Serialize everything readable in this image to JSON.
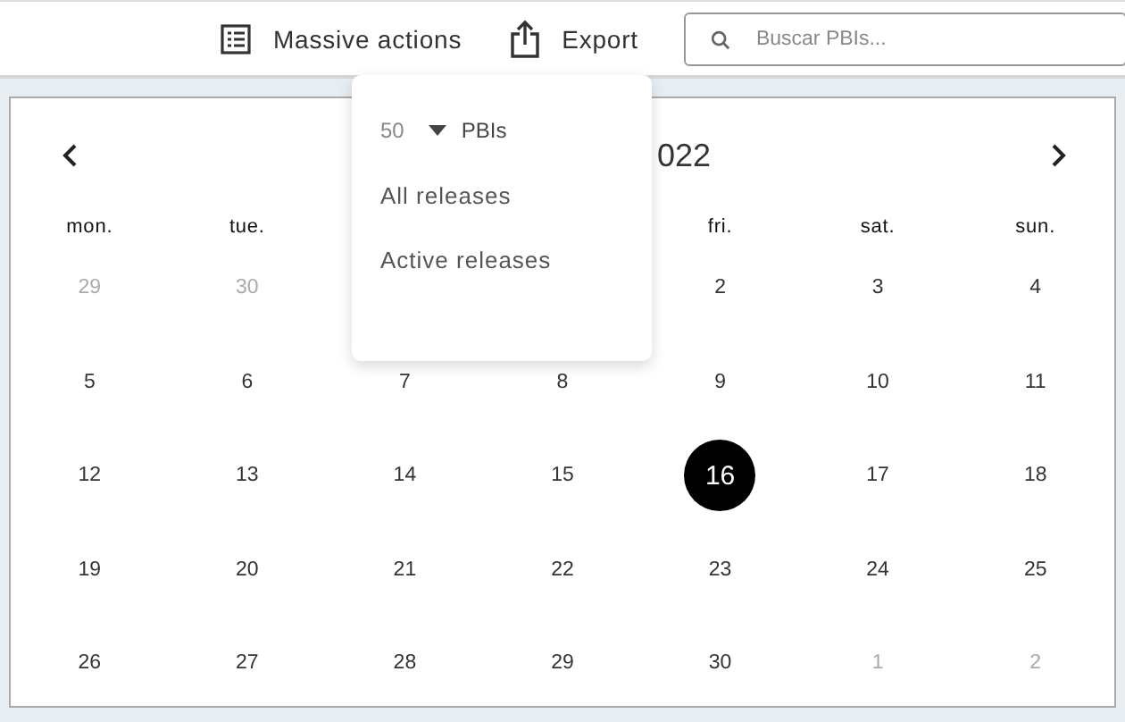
{
  "toolbar": {
    "massive_actions": "Massive actions",
    "export": "Export",
    "search": {
      "placeholder": "Buscar PBIs..."
    }
  },
  "calendar": {
    "title_visible": "022",
    "weekdays": {
      "left": [
        "mon.",
        "tue."
      ],
      "right": [
        "fri.",
        "sat.",
        "sun."
      ]
    },
    "first_week": {
      "left": [
        {
          "day": "29",
          "muted": true,
          "selected": false
        },
        {
          "day": "30",
          "muted": true,
          "selected": false
        }
      ],
      "right": [
        {
          "day": "2",
          "muted": false,
          "selected": false
        },
        {
          "day": "3",
          "muted": false,
          "selected": false
        },
        {
          "day": "4",
          "muted": false,
          "selected": false
        }
      ]
    },
    "weeks": [
      [
        {
          "day": "5",
          "muted": false,
          "selected": false
        },
        {
          "day": "6",
          "muted": false,
          "selected": false
        },
        {
          "day": "7",
          "muted": false,
          "selected": false
        },
        {
          "day": "8",
          "muted": false,
          "selected": false
        },
        {
          "day": "9",
          "muted": false,
          "selected": false
        },
        {
          "day": "10",
          "muted": false,
          "selected": false
        },
        {
          "day": "11",
          "muted": false,
          "selected": false
        }
      ],
      [
        {
          "day": "12",
          "muted": false,
          "selected": false
        },
        {
          "day": "13",
          "muted": false,
          "selected": false
        },
        {
          "day": "14",
          "muted": false,
          "selected": false
        },
        {
          "day": "15",
          "muted": false,
          "selected": false
        },
        {
          "day": "16",
          "muted": false,
          "selected": true
        },
        {
          "day": "17",
          "muted": false,
          "selected": false
        },
        {
          "day": "18",
          "muted": false,
          "selected": false
        }
      ],
      [
        {
          "day": "19",
          "muted": false,
          "selected": false
        },
        {
          "day": "20",
          "muted": false,
          "selected": false
        },
        {
          "day": "21",
          "muted": false,
          "selected": false
        },
        {
          "day": "22",
          "muted": false,
          "selected": false
        },
        {
          "day": "23",
          "muted": false,
          "selected": false
        },
        {
          "day": "24",
          "muted": false,
          "selected": false
        },
        {
          "day": "25",
          "muted": false,
          "selected": false
        }
      ],
      [
        {
          "day": "26",
          "muted": false,
          "selected": false
        },
        {
          "day": "27",
          "muted": false,
          "selected": false
        },
        {
          "day": "28",
          "muted": false,
          "selected": false
        },
        {
          "day": "29",
          "muted": false,
          "selected": false
        },
        {
          "day": "30",
          "muted": false,
          "selected": false
        },
        {
          "day": "1",
          "muted": true,
          "selected": false
        },
        {
          "day": "2",
          "muted": true,
          "selected": false
        }
      ]
    ]
  },
  "dropdown": {
    "count": "50",
    "count_label": "PBIs",
    "items": [
      "All releases",
      "Active releases"
    ]
  }
}
